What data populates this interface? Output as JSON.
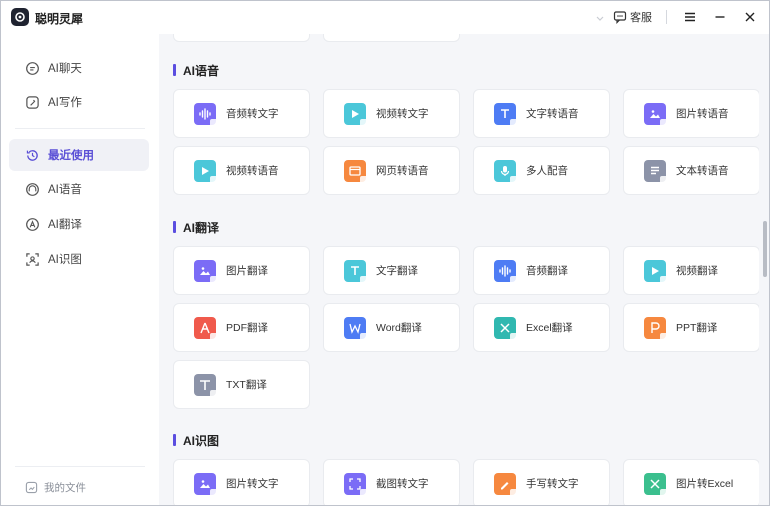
{
  "app": {
    "title": "聪明灵犀",
    "service_label": "客服",
    "logo_icon": "app-logo-icon"
  },
  "colors": {
    "accent": "#5b4ee0",
    "sidebar_active_bg": "#f0f1f6",
    "icon_purple": "#7b6cf6",
    "icon_blue": "#4e7cf4",
    "icon_cyan": "#4bc7d9",
    "icon_orange": "#f6883f",
    "icon_red": "#f05a4c",
    "icon_teal": "#30b8b0",
    "icon_gray": "#8c93a8",
    "icon_green": "#3bbf8e"
  },
  "sidebar": {
    "items": [
      {
        "label": "AI聊天",
        "icon": "chat-icon"
      },
      {
        "label": "AI写作",
        "icon": "pen-icon"
      },
      {
        "label": "最近使用",
        "icon": "recent-icon",
        "active": true
      },
      {
        "label": "AI语音",
        "icon": "voice-icon"
      },
      {
        "label": "AI翻译",
        "icon": "translate-icon"
      },
      {
        "label": "AI识图",
        "icon": "scan-icon"
      }
    ],
    "footer_label": "我的文件"
  },
  "sections": [
    {
      "title": "AI语音",
      "cards": [
        {
          "label": "音频转文字",
          "color": "#7b6cf6",
          "icon": "audio-wave-icon"
        },
        {
          "label": "视频转文字",
          "color": "#4bc7d9",
          "icon": "video-icon"
        },
        {
          "label": "文字转语音",
          "color": "#4e7cf4",
          "icon": "text-icon"
        },
        {
          "label": "图片转语音",
          "color": "#7b6cf6",
          "icon": "image-icon"
        },
        {
          "label": "视频转语音",
          "color": "#4bc7d9",
          "icon": "video-icon"
        },
        {
          "label": "网页转语音",
          "color": "#f6883f",
          "icon": "web-icon"
        },
        {
          "label": "多人配音",
          "color": "#4bc7d9",
          "icon": "mic-icon"
        },
        {
          "label": "文本转语音",
          "color": "#8c93a8",
          "icon": "document-icon"
        }
      ]
    },
    {
      "title": "AI翻译",
      "cards": [
        {
          "label": "图片翻译",
          "color": "#7b6cf6",
          "icon": "image-icon"
        },
        {
          "label": "文字翻译",
          "color": "#4bc7d9",
          "icon": "text-icon"
        },
        {
          "label": "音频翻译",
          "color": "#4e7cf4",
          "icon": "audio-wave-icon"
        },
        {
          "label": "视频翻译",
          "color": "#4bc7d9",
          "icon": "video-icon"
        },
        {
          "label": "PDF翻译",
          "color": "#f05a4c",
          "icon": "pdf-icon"
        },
        {
          "label": "Word翻译",
          "color": "#4e7cf4",
          "icon": "word-icon"
        },
        {
          "label": "Excel翻译",
          "color": "#30b8b0",
          "icon": "excel-icon"
        },
        {
          "label": "PPT翻译",
          "color": "#f6883f",
          "icon": "ppt-icon"
        },
        {
          "label": "TXT翻译",
          "color": "#8c93a8",
          "icon": "txt-icon"
        }
      ]
    },
    {
      "title": "AI识图",
      "cards": [
        {
          "label": "图片转文字",
          "color": "#7b6cf6",
          "icon": "image-icon"
        },
        {
          "label": "截图转文字",
          "color": "#7b6cf6",
          "icon": "screenshot-icon"
        },
        {
          "label": "手写转文字",
          "color": "#f6883f",
          "icon": "handwriting-icon"
        },
        {
          "label": "图片转Excel",
          "color": "#3bbf8e",
          "icon": "excel-icon"
        }
      ]
    }
  ]
}
